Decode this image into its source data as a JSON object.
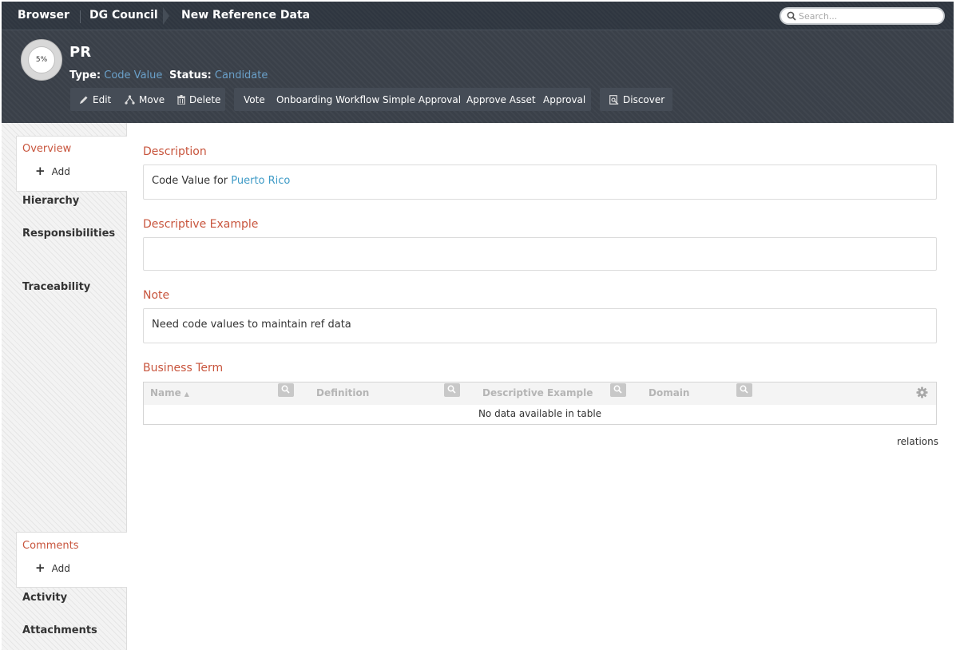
{
  "breadcrumb": {
    "items": [
      "Browser",
      "DG Council",
      "New Reference Data"
    ]
  },
  "search": {
    "placeholder": "Search..."
  },
  "asset": {
    "progress": "5%",
    "name": "PR",
    "type_label": "Type:",
    "type_value": "Code Value",
    "status_label": "Status:",
    "status_value": "Candidate"
  },
  "toolbar": {
    "edit": "Edit",
    "move": "Move",
    "delete": "Delete",
    "vote": "Vote",
    "onboarding": "Onboarding Workflow",
    "simple_approval": "Simple Approval",
    "approve_asset": "Approve Asset",
    "approval": "Approval",
    "discover": "Discover"
  },
  "leftnav": {
    "overview": "Overview",
    "add": "Add",
    "hierarchy": "Hierarchy",
    "responsibilities": "Responsibilities",
    "traceability": "Traceability",
    "comments": "Comments",
    "comments_add": "Add",
    "activity": "Activity",
    "attachments": "Attachments"
  },
  "main": {
    "description_title": "Description",
    "description_text": "Code Value for ",
    "description_link": "Puerto Rico",
    "example_title": "Descriptive Example",
    "example_text": "",
    "note_title": "Note",
    "note_text": "Need code values to maintain ref data",
    "business_term_title": "Business Term",
    "table": {
      "columns": [
        "Name",
        "Definition",
        "Descriptive Example",
        "Domain"
      ],
      "sort_indicator": "▲",
      "empty_text": "No data available in table"
    },
    "relations": "relations"
  },
  "colors": {
    "accent": "#c8553d",
    "link": "#3d9ac6",
    "header_bg": "#3a4049"
  }
}
